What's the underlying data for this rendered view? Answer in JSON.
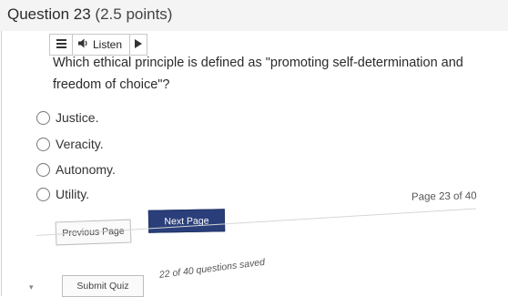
{
  "question": {
    "title": "Question 23",
    "points": "(2.5 points)",
    "text": "Which ethical principle is defined as \"promoting self-determination and freedom of choice\"?",
    "options": [
      "Justice.",
      "Veracity.",
      "Autonomy.",
      "Utility."
    ]
  },
  "toolbar": {
    "listen_label": "Listen",
    "icons": [
      "menu-icon",
      "speaker-icon",
      "play-icon"
    ]
  },
  "navigation": {
    "page_info": "Page 23 of 40",
    "previous_label": "Previous Page",
    "next_label": "Next Page",
    "submit_label": "Submit Quiz",
    "saved_status": "22 of 40 questions saved"
  },
  "colors": {
    "next_button": "#2a3f7a",
    "header_bg": "#f4f4f4"
  }
}
